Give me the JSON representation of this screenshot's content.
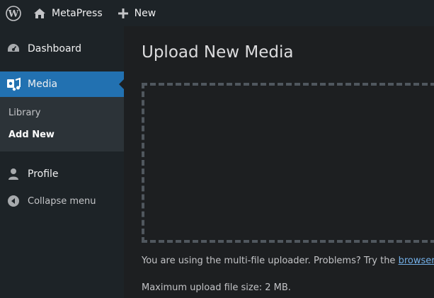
{
  "admin_bar": {
    "site_name": "MetaPress",
    "new_label": "New"
  },
  "sidebar": {
    "dashboard_label": "Dashboard",
    "media_label": "Media",
    "submenu": [
      "Library",
      "Add New"
    ],
    "profile_label": "Profile",
    "collapse_label": "Collapse menu"
  },
  "main": {
    "title": "Upload New Media",
    "uploader_note_prefix": "You are using the multi-file uploader. Problems? Try the ",
    "uploader_note_link": "browser",
    "max_size_text": "Maximum upload file size: 2 MB."
  },
  "colors": {
    "accent": "#2271b1",
    "admin_bar": "#1d2327",
    "link": "#72aee6"
  }
}
